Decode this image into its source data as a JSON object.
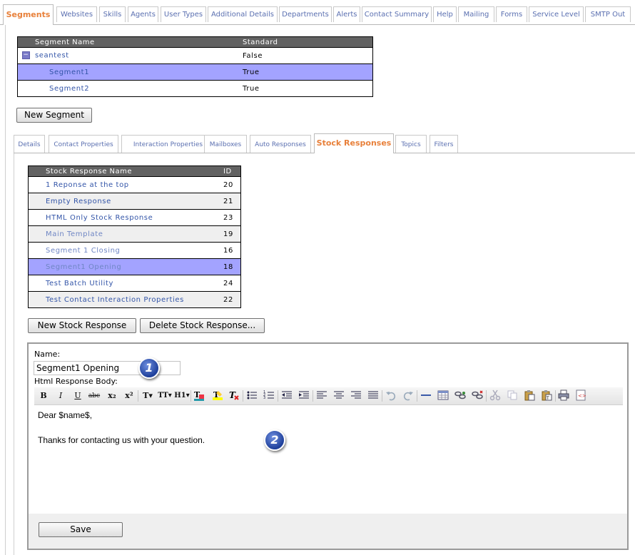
{
  "top_tabs": [
    "Segments",
    "Websites",
    "Skills",
    "Agents",
    "User Types",
    "Additional Details",
    "Departments",
    "Alerts",
    "Contact Summary",
    "Help",
    "Mailing",
    "Forms",
    "Service Level",
    "SMTP Out"
  ],
  "segments_table": {
    "headers": [
      "Segment Name",
      "Standard"
    ],
    "rows": [
      {
        "name": "seantest",
        "standard": "False"
      },
      {
        "name": "Segment1",
        "standard": "True"
      },
      {
        "name": "Segment2",
        "standard": "True"
      }
    ]
  },
  "new_segment_label": "New Segment",
  "sub_tabs": [
    "Details",
    "Contact Properties",
    "Interaction Properties",
    "Mailboxes",
    "Auto Responses",
    "Stock Responses",
    "Topics",
    "Filters"
  ],
  "stock_table": {
    "headers": [
      "Stock Response Name",
      "ID"
    ],
    "rows": [
      {
        "name": "1 Reponse at the top",
        "id": "20"
      },
      {
        "name": "Empty Response",
        "id": "21"
      },
      {
        "name": "HTML Only Stock Response",
        "id": "23"
      },
      {
        "name": "Main Template",
        "id": "19"
      },
      {
        "name": "Segment 1 Closing",
        "id": "16"
      },
      {
        "name": "Segment1 Opening",
        "id": "18"
      },
      {
        "name": "Test Batch Utility",
        "id": "24"
      },
      {
        "name": "Test Contact Interaction Properties",
        "id": "22"
      }
    ]
  },
  "new_stock_label": "New Stock Response",
  "delete_stock_label": "Delete Stock Response...",
  "editor": {
    "name_label": "Name:",
    "name_value": "Segment1 Opening",
    "body_label": "Html Response Body:",
    "body_line1": "Dear $name$,",
    "body_line2": "Thanks for contacting us with your question.",
    "save_label": "Save"
  },
  "toolbar": {
    "bold": "B",
    "italic": "I",
    "underline": "U",
    "strike": "abc",
    "subscript": "x₂",
    "superscript": "x²",
    "font_size": "T▾",
    "font_family": "TT▾",
    "heading": "H1▾"
  },
  "markers": [
    "1",
    "2"
  ],
  "colors": {
    "active_tab": "#e8803a",
    "link": "#3355a8",
    "selected_row": "#a3a3ff",
    "header": "#626262"
  }
}
